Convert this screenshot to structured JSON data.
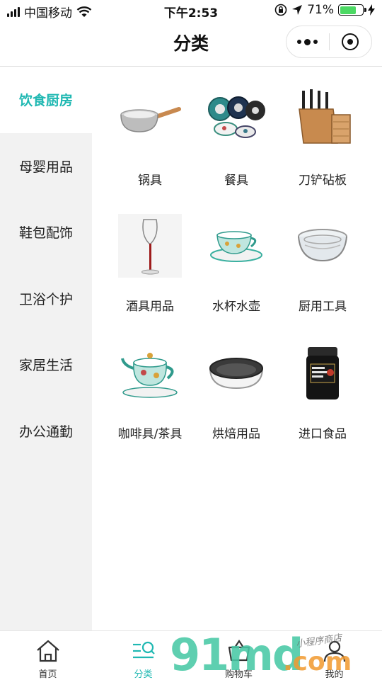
{
  "status_bar": {
    "carrier": "中国移动",
    "time": "下午2:53",
    "battery": "71%",
    "battery_level": 0.71
  },
  "nav": {
    "title": "分类"
  },
  "sidebar": {
    "items": [
      {
        "label": "饮食厨房",
        "active": true
      },
      {
        "label": "母婴用品",
        "active": false
      },
      {
        "label": "鞋包配饰",
        "active": false
      },
      {
        "label": "卫浴个护",
        "active": false
      },
      {
        "label": "家居生活",
        "active": false
      },
      {
        "label": "办公通勤",
        "active": false
      }
    ]
  },
  "products": [
    {
      "label": "锅具",
      "icon": "saucepan"
    },
    {
      "label": "餐具",
      "icon": "plates"
    },
    {
      "label": "刀铲砧板",
      "icon": "knife-block"
    },
    {
      "label": "酒具用品",
      "icon": "wine-glass"
    },
    {
      "label": "水杯水壶",
      "icon": "teacup"
    },
    {
      "label": "厨用工具",
      "icon": "glass-bowl"
    },
    {
      "label": "咖啡具/茶具",
      "icon": "teapot"
    },
    {
      "label": "烘焙用品",
      "icon": "baking-pan"
    },
    {
      "label": "进口食品",
      "icon": "honey-jar"
    }
  ],
  "tab_bar": {
    "tabs": [
      {
        "label": "首页",
        "icon": "home-icon"
      },
      {
        "label": "分类",
        "icon": "category-icon",
        "active": true
      },
      {
        "label": "购物车",
        "icon": "cart-icon"
      },
      {
        "label": "我的",
        "icon": "user-icon"
      }
    ]
  },
  "watermark": {
    "main": "91md",
    "suffix": ".com",
    "tag": "小程序商店"
  },
  "colors": {
    "accent": "#1fb8b2",
    "sidebar_bg": "#f2f2f2"
  }
}
